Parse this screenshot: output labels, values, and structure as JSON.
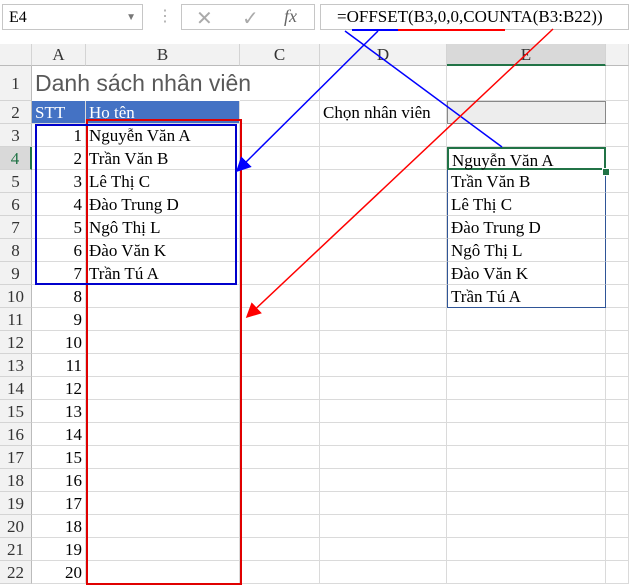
{
  "formula_bar": {
    "name_box": "E4",
    "cancel_icon": "✕",
    "enter_icon": "✓",
    "fx_label": "fx",
    "formula": "=OFFSET(B3,0,0,COUNTA(B3:B22))"
  },
  "columns": [
    "A",
    "B",
    "C",
    "D",
    "E"
  ],
  "rows": [
    "1",
    "2",
    "3",
    "4",
    "5",
    "6",
    "7",
    "8",
    "9",
    "10",
    "11",
    "12",
    "13",
    "14",
    "15",
    "16",
    "17",
    "18",
    "19",
    "20",
    "21",
    "22"
  ],
  "title": "Danh sách nhân viên",
  "table_header": {
    "stt": "STT",
    "name": "Họ tên"
  },
  "stt": [
    "1",
    "2",
    "3",
    "4",
    "5",
    "6",
    "7",
    "8",
    "9",
    "10",
    "11",
    "12",
    "13",
    "14",
    "15",
    "16",
    "17",
    "18",
    "19",
    "20"
  ],
  "names": [
    "Nguyễn Văn A",
    "Trần Văn B",
    "Lê Thị C",
    "Đào Trung D",
    "Ngô Thị L",
    "Đào Văn K",
    "Trần Tú A"
  ],
  "select_label": "Chọn nhân viên",
  "accents": {
    "blue": "#0000ff",
    "red": "#ff0000",
    "header": "#4472c4",
    "selection": "#217346"
  }
}
